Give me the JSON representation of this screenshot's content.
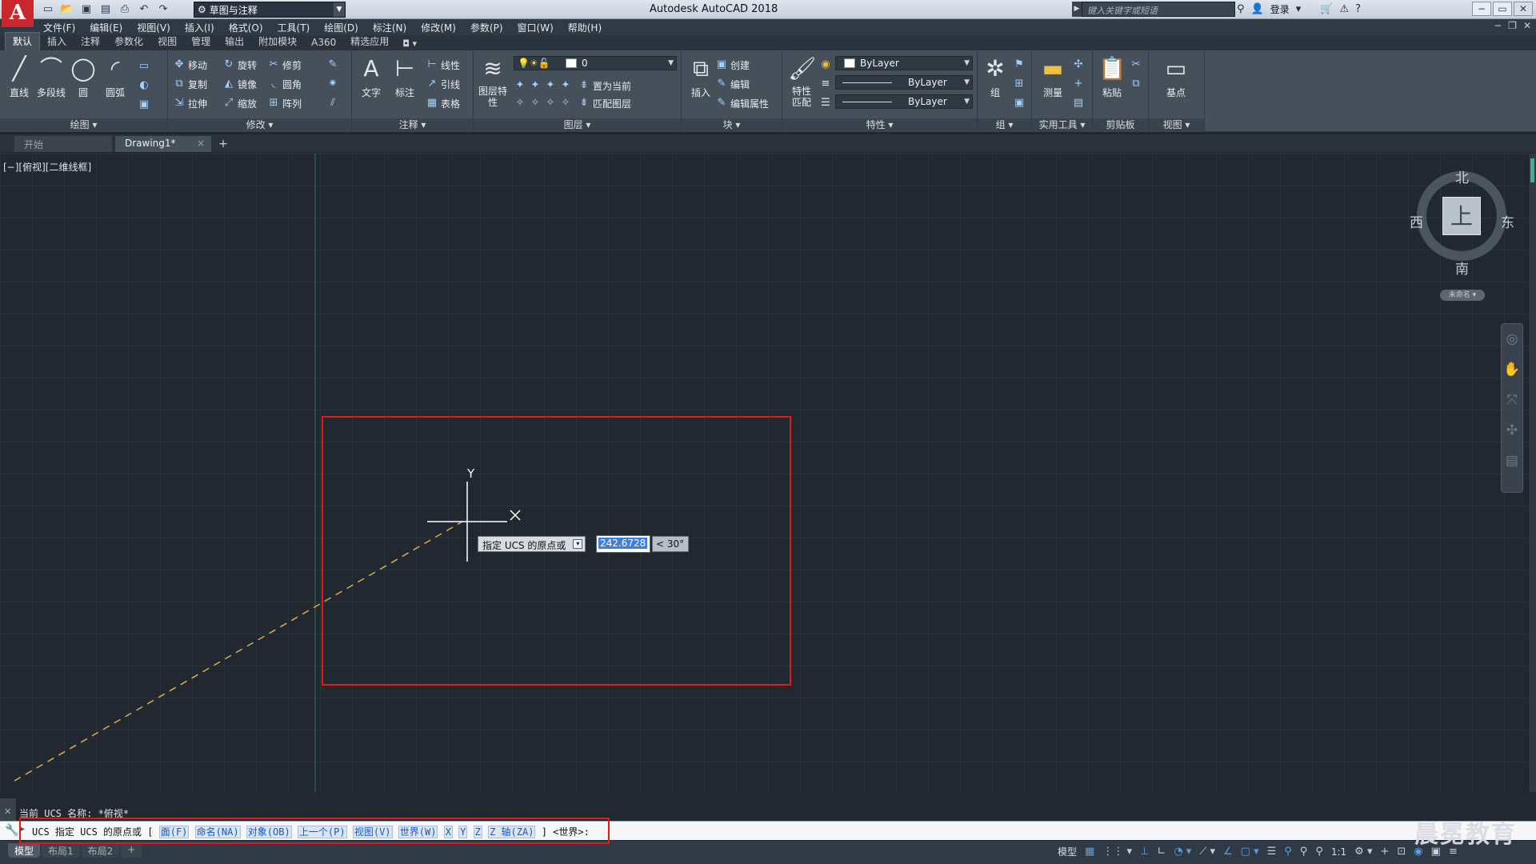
{
  "titlebar": {
    "title": "Autodesk AutoCAD 2018",
    "logo": "A",
    "workspace": "草图与注释",
    "search_placeholder": "键入关键字或短语",
    "login": "登录"
  },
  "menu": [
    "文件(F)",
    "编辑(E)",
    "视图(V)",
    "插入(I)",
    "格式(O)",
    "工具(T)",
    "绘图(D)",
    "标注(N)",
    "修改(M)",
    "参数(P)",
    "窗口(W)",
    "帮助(H)"
  ],
  "ribbon_tabs": [
    "默认",
    "插入",
    "注释",
    "参数化",
    "视图",
    "管理",
    "输出",
    "附加模块",
    "A360",
    "精选应用"
  ],
  "ribbon": {
    "draw": {
      "title": "绘图 ▾",
      "line": "直线",
      "polyline": "多段线",
      "circle": "圆",
      "arc": "圆弧"
    },
    "modify": {
      "title": "修改 ▾",
      "move": "移动",
      "rotate": "旋转",
      "trim": "修剪",
      "copy": "复制",
      "mirror": "镜像",
      "fillet": "圆角",
      "stretch": "拉伸",
      "scale": "缩放",
      "array": "阵列"
    },
    "annotation": {
      "title": "注释 ▾",
      "text": "文字",
      "dimension": "标注",
      "linear": "线性",
      "leader": "引线",
      "table": "表格"
    },
    "layers": {
      "title": "图层 ▾",
      "layer_props": "图层特性",
      "layer_value": "0",
      "set_current": "置为当前",
      "match_layer": "匹配图层"
    },
    "block": {
      "title": "块 ▾",
      "insert": "插入",
      "create": "创建",
      "edit": "编辑",
      "edit_attr": "编辑属性"
    },
    "properties": {
      "title": "特性 ▾",
      "match": "特性匹配",
      "color": "ByLayer",
      "linetype": "ByLayer",
      "lineweight": "ByLayer"
    },
    "groups": {
      "title": "组 ▾",
      "group": "组"
    },
    "utilities": {
      "title": "实用工具 ▾",
      "measure": "测量"
    },
    "clipboard": {
      "title": "剪贴板",
      "paste": "粘贴"
    },
    "view": {
      "title": "视图 ▾",
      "base": "基点"
    }
  },
  "doc_tabs": {
    "start": "开始",
    "drawing": "Drawing1*"
  },
  "viewport": {
    "label": "[−][俯视][二维线框]",
    "compass": {
      "north": "北",
      "south": "南",
      "east": "东",
      "west": "西",
      "face": "上"
    },
    "ucs_name": "未命名 ▾",
    "cursor_y_label": "Y"
  },
  "dynamic_input": {
    "prompt": "指定 UCS 的原点或",
    "value": "242.6728",
    "angle": "< 30°"
  },
  "command": {
    "history": "当前 UCS 名称: *俯视*",
    "prefix": "UCS 指定 UCS 的原点或 [",
    "options": [
      "面(F)",
      "命名(NA)",
      "对象(OB)",
      "上一个(P)",
      "视图(V)",
      "世界(W)",
      "X",
      "Y",
      "Z",
      "Z 轴(ZA)"
    ],
    "suffix": "] <世界>:"
  },
  "layout_tabs": [
    "模型",
    "布局1",
    "布局2"
  ],
  "status": {
    "model": "模型",
    "scale": "1:1"
  },
  "watermark": "晨冕教育",
  "colors": {
    "accent_red": "#e0191b",
    "selection": "#3d7fe0",
    "dash_line": "#d9b04a"
  }
}
